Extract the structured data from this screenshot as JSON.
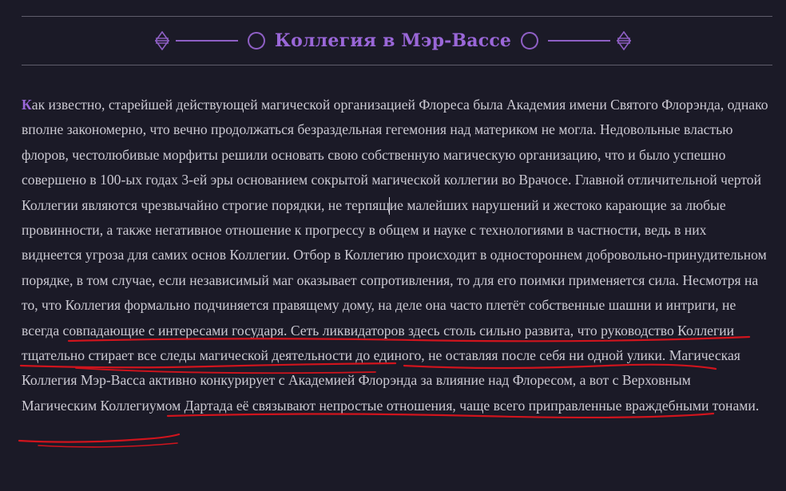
{
  "header": {
    "title": "Коллегия в Мэр-Вассе",
    "accent_color": "#9a67d8",
    "underline_color": "#d0141d"
  },
  "article": {
    "drop_cap": "К",
    "part1": "ак известно, старейшей действующей магической организацией Флореса была Академия имени Святого Флорэнда, однако вполне закономерно, что вечно продолжаться безраздельная гегемония над материком не могла. Недовольные властью флоров, честолюбивые морфиты решили основать свою собственную магическую организацию, что и было успешно совершено в 100-ых годах 3-ей эры основанием сокрытой магической коллегии во Врачосе. Главной отличительной чертой Коллегии являются чрезвычайно строгие порядки, не терпящие малейших нарушений и жестоко карающие за любые провинности, а также негативное отношение к прогрессу в общем и науке с технологиями в частности, ведь в них виднеется угроза для самих основ Коллегии. Отбор в Коллегию происходит в одностороннем добровольно-принудительном порядке, в том случае, если независимый маг оказывает сопротивления, то для его поимки применяется сила. Несмотря на то, что ",
    "underlined1": "Коллегия формально подчиняется правящему дому, на деле она часто плетёт собственные шашни и интриги, не всегда совпадающие с интересами государя",
    "part2": ". ",
    "underlined2": "Сеть ликвидаторов здесь столь сильно развита",
    "part3": ", что руководство Коллегии тщательно стирает все следы магической деятельности до единого, не оставляя после себя ни одной улики. ",
    "underlined3": "Магическая Коллегия Мэр-Васса активно конкурирует с Академией Флорэнда за влияние над Флоресом",
    "part4": ", а вот с Верховным Магическим Коллегиумом Дартада её связывают непростые отношения, чаще всего приправленные враждебными тонами."
  }
}
